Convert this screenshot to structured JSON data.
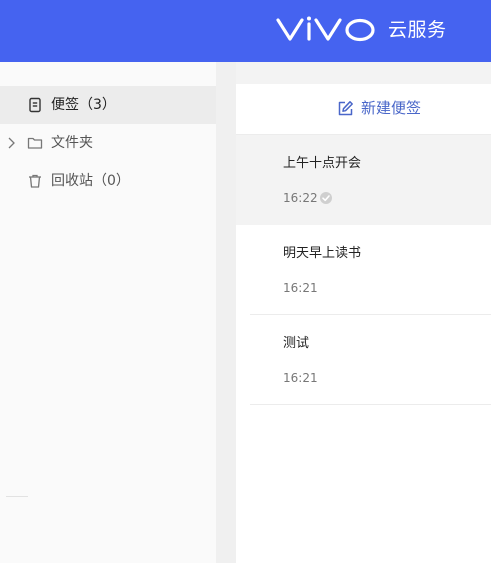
{
  "header": {
    "brand": "vivo",
    "title": "云服务",
    "bg_color": "#4563f0"
  },
  "sidebar": {
    "items": [
      {
        "label": "便签（3）",
        "icon": "note-icon",
        "active": true
      },
      {
        "label": "文件夹",
        "icon": "folder-icon",
        "expand_icon": "chevron-right-icon",
        "active": false
      },
      {
        "label": "回收站（0）",
        "icon": "trash-icon",
        "active": false
      }
    ]
  },
  "notes_panel": {
    "new_note_label": "新建便签",
    "new_note_icon": "edit-icon",
    "accent_color": "#4a67c9",
    "notes": [
      {
        "title": "上午十点开会",
        "time": "16:22",
        "synced": true,
        "selected": true
      },
      {
        "title": "明天早上读书",
        "time": "16:21",
        "synced": false,
        "selected": false
      },
      {
        "title": "测试",
        "time": "16:21",
        "synced": false,
        "selected": false
      }
    ]
  }
}
